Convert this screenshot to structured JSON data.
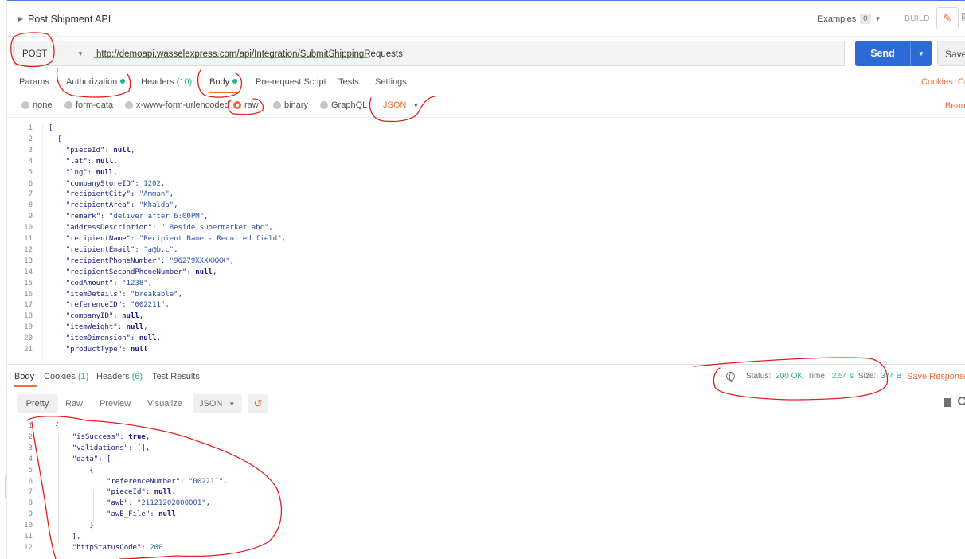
{
  "request": {
    "title": "Post Shipment API",
    "examples_label": "Examples",
    "examples_count": "0",
    "build_label": "BUILD",
    "method": "POST",
    "url": "http://demoapi.wasselexpress.com/api/Integration/SubmitShippingRequests",
    "send_label": "Send",
    "save_label": "Save"
  },
  "request_tabs": {
    "params": "Params",
    "authorization": "Authorization",
    "headers": "Headers",
    "headers_count": "(10)",
    "body": "Body",
    "prerequest": "Pre-request Script",
    "tests": "Tests",
    "settings": "Settings",
    "cookies": "Cookies",
    "code": "Co"
  },
  "body_options": {
    "none": "none",
    "form_data": "form-data",
    "urlencoded": "x-www-form-urlencoded",
    "raw": "raw",
    "binary": "binary",
    "graphql": "GraphQL",
    "language": "JSON",
    "beautify": "Beautif"
  },
  "request_body_lines": [
    {
      "n": "1",
      "text": "["
    },
    {
      "n": "2",
      "text": "  {"
    },
    {
      "n": "3",
      "text": "    \"pieceId\": null,"
    },
    {
      "n": "4",
      "text": "    \"lat\": null,"
    },
    {
      "n": "5",
      "text": "    \"lng\": null,"
    },
    {
      "n": "6",
      "text": "    \"companyStoreID\": 1202,"
    },
    {
      "n": "7",
      "text": "    \"recipientCity\": \"Amman\","
    },
    {
      "n": "8",
      "text": "    \"recipientArea\": \"Khalda\","
    },
    {
      "n": "9",
      "text": "    \"remark\": \"deliver after 6:00PM\","
    },
    {
      "n": "10",
      "text": "    \"addressDescription\": \" Beside supermarket abc\","
    },
    {
      "n": "11",
      "text": "    \"recipientName\": \"Recipient Name - Required field\","
    },
    {
      "n": "12",
      "text": "    \"recipientEmail\": \"a@b.c\","
    },
    {
      "n": "13",
      "text": "    \"recipientPhoneNumber\": \"96279XXXXXXX\","
    },
    {
      "n": "14",
      "text": "    \"recipientSecondPhoneNumber\": null,"
    },
    {
      "n": "15",
      "text": "    \"codAmount\": \"1238\","
    },
    {
      "n": "16",
      "text": "    \"itemDetails\": \"breakable\","
    },
    {
      "n": "17",
      "text": "    \"referenceID\": \"002211\","
    },
    {
      "n": "18",
      "text": "    \"companyID\": null,"
    },
    {
      "n": "19",
      "text": "    \"itemWeight\": null,"
    },
    {
      "n": "20",
      "text": "    \"itemDimension\": null,"
    },
    {
      "n": "21",
      "text": "    \"productType\": null"
    }
  ],
  "response_tabs": {
    "body": "Body",
    "cookies": "Cookies",
    "cookies_count": "(1)",
    "headers": "Headers",
    "headers_count": "(6)",
    "test_results": "Test Results",
    "status_label": "Status:",
    "status_value": "200 OK",
    "time_label": "Time:",
    "time_value": "2.54 s",
    "size_label": "Size:",
    "size_value": "374 B",
    "save_response": "Save Response"
  },
  "response_options": {
    "pretty": "Pretty",
    "raw": "Raw",
    "preview": "Preview",
    "visualize": "Visualize",
    "language": "JSON"
  },
  "response_body_lines": [
    {
      "n": "1",
      "text": "{"
    },
    {
      "n": "2",
      "text": "    \"isSuccess\": true,"
    },
    {
      "n": "3",
      "text": "    \"validations\": [],"
    },
    {
      "n": "4",
      "text": "    \"data\": ["
    },
    {
      "n": "5",
      "text": "        {"
    },
    {
      "n": "6",
      "text": "            \"referenceNumber\": \"002211\","
    },
    {
      "n": "7",
      "text": "            \"pieceId\": null,"
    },
    {
      "n": "8",
      "text": "            \"awb\": \"21121202000001\","
    },
    {
      "n": "9",
      "text": "            \"awB_File\": null"
    },
    {
      "n": "10",
      "text": "        }"
    },
    {
      "n": "11",
      "text": "    ],"
    },
    {
      "n": "12",
      "text": "    \"httpStatusCode\": 200"
    }
  ],
  "colors": {
    "accent": "#f26b3a",
    "send": "#2c6bd6",
    "success": "#26b47f",
    "annotation": "#e0201c"
  }
}
